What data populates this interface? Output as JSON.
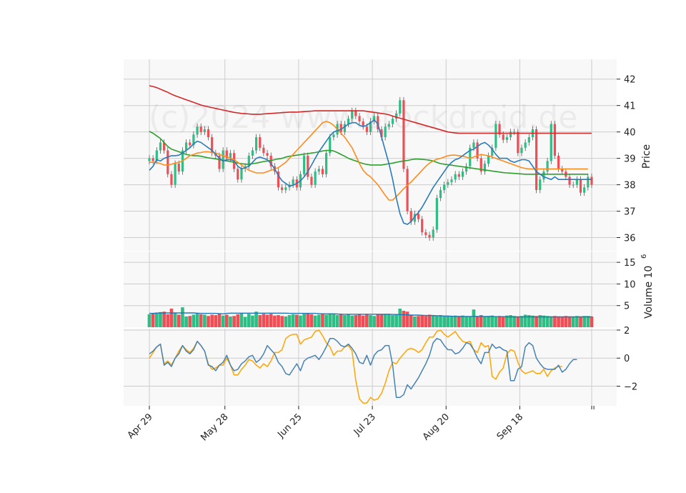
{
  "watermark": "(c)2024 www.stockdroid.de",
  "colors": {
    "up": "#2ebd85",
    "down": "#f04d55",
    "ma_short": "#2b7bb9",
    "ma_mid": "#ff8c1a",
    "ma_long1": "#2ca02c",
    "ma_long2": "#d62728",
    "vol_avg": "#1f77b4",
    "osc_a": "#4682b4",
    "osc_b": "#ffa500",
    "grid": "#cccccc",
    "panel_bg": "#f8f8f8"
  },
  "chart_data": {
    "type": "candlestick",
    "x_tick_labels": [
      "Apr 29",
      "May 28",
      "Jun 25",
      "Jul 23",
      "Aug 20",
      "Sep 18"
    ],
    "panels": {
      "price": {
        "ylabel": "Price",
        "yticks": [
          36,
          37,
          38,
          39,
          40,
          41,
          42
        ],
        "ylim": [
          35.5,
          42.75
        ]
      },
      "volume": {
        "ylabel": "Volume  10",
        "ylabel_exponent": "6",
        "yticks": [
          5,
          10,
          15
        ],
        "ylim": [
          0,
          17.5
        ]
      },
      "oscillator": {
        "yticks": [
          -2,
          0,
          2
        ],
        "ylim": [
          -3.4,
          2.1
        ]
      }
    },
    "close": [
      39.0,
      38.9,
      39.3,
      39.6,
      39.3,
      38.4,
      38.0,
      38.8,
      38.5,
      39.3,
      39.6,
      39.5,
      39.9,
      40.2,
      40.0,
      40.1,
      39.8,
      39.2,
      39.1,
      38.6,
      39.3,
      39.0,
      39.2,
      38.6,
      38.2,
      38.6,
      38.7,
      39.1,
      39.3,
      39.8,
      39.4,
      39.2,
      39.1,
      38.7,
      38.5,
      37.9,
      37.8,
      37.9,
      38.0,
      38.2,
      37.9,
      38.4,
      39.1,
      38.3,
      38.0,
      38.5,
      38.6,
      38.4,
      39.2,
      39.8,
      39.9,
      40.3,
      40.0,
      40.3,
      40.5,
      40.8,
      40.6,
      40.4,
      40.2,
      40.0,
      40.4,
      40.6,
      40.1,
      39.8,
      40.2,
      40.3,
      40.5,
      40.7,
      41.2,
      38.6,
      37.0,
      36.6,
      36.9,
      36.7,
      36.2,
      36.1,
      36.0,
      36.3,
      37.5,
      37.8,
      38.0,
      38.1,
      38.2,
      38.4,
      38.3,
      38.5,
      38.7,
      39.4,
      39.6,
      39.0,
      38.5,
      38.8,
      39.1,
      39.4,
      40.3,
      39.9,
      39.7,
      39.8,
      40.0,
      40.0,
      39.2,
      39.4,
      39.6,
      39.8,
      40.1,
      37.8,
      38.2,
      38.5,
      38.9,
      40.3,
      39.1,
      38.6,
      38.5,
      38.3,
      38.0,
      38.0,
      38.2,
      37.7,
      37.9,
      38.3,
      38.0
    ],
    "ma_short": [
      38.55,
      38.7,
      38.95,
      38.9,
      39.0,
      39.05,
      39.1,
      39.1,
      39.12,
      39.2,
      39.3,
      39.4,
      39.55,
      39.65,
      39.6,
      39.5,
      39.4,
      39.3,
      39.15,
      39.0,
      38.9,
      38.95,
      38.95,
      38.9,
      38.7,
      38.6,
      38.65,
      38.7,
      38.85,
      39.0,
      39.05,
      39.0,
      38.95,
      38.8,
      38.6,
      38.35,
      38.15,
      38.05,
      37.95,
      37.98,
      38.05,
      38.15,
      38.3,
      38.5,
      38.75,
      39.0,
      39.25,
      39.45,
      39.65,
      39.85,
      40.0,
      40.05,
      40.1,
      40.2,
      40.3,
      40.35,
      40.35,
      40.25,
      40.2,
      40.25,
      40.35,
      40.45,
      40.3,
      39.8,
      39.3,
      38.8,
      38.2,
      37.5,
      36.9,
      36.55,
      36.5,
      36.6,
      36.8,
      36.95,
      37.15,
      37.4,
      37.65,
      37.9,
      38.1,
      38.3,
      38.5,
      38.7,
      38.85,
      38.95,
      39.0,
      39.1,
      39.2,
      39.3,
      39.35,
      39.45,
      39.55,
      39.6,
      39.5,
      39.35,
      39.15,
      39.0,
      39.0,
      39.0,
      38.9,
      38.85,
      38.9,
      38.95,
      38.95,
      38.9,
      38.7,
      38.5,
      38.4,
      38.3,
      38.25,
      38.2,
      38.3,
      38.2,
      38.2,
      38.2,
      38.2,
      38.2,
      38.2,
      38.2,
      38.2,
      38.2,
      38.2
    ],
    "ma_mid": [
      38.85,
      38.85,
      38.85,
      38.8,
      38.75,
      38.75,
      38.78,
      38.82,
      38.85,
      38.9,
      39.0,
      39.1,
      39.15,
      39.2,
      39.22,
      39.25,
      39.25,
      39.22,
      39.2,
      39.15,
      39.1,
      39.05,
      39.0,
      38.95,
      38.85,
      38.75,
      38.65,
      38.55,
      38.5,
      38.45,
      38.45,
      38.45,
      38.5,
      38.55,
      38.6,
      38.65,
      38.75,
      38.85,
      39.0,
      39.15,
      39.3,
      39.45,
      39.6,
      39.75,
      39.9,
      40.05,
      40.2,
      40.35,
      40.4,
      40.35,
      40.25,
      40.1,
      39.95,
      39.8,
      39.6,
      39.4,
      39.1,
      38.8,
      38.55,
      38.4,
      38.3,
      38.15,
      38.0,
      37.8,
      37.6,
      37.42,
      37.42,
      37.55,
      37.7,
      37.85,
      37.98,
      38.1,
      38.25,
      38.4,
      38.55,
      38.7,
      38.82,
      38.9,
      38.97,
      39.0,
      39.05,
      39.1,
      39.12,
      39.12,
      39.1,
      39.08,
      39.05,
      39.0,
      39.05,
      39.1,
      39.15,
      39.12,
      39.1,
      39.05,
      39.0,
      38.95,
      38.9,
      38.85,
      38.8,
      38.75,
      38.7,
      38.65,
      38.62,
      38.6,
      38.6,
      38.6,
      38.6,
      38.6,
      38.6,
      38.6,
      38.6,
      38.6,
      38.6,
      38.6,
      38.6,
      38.6,
      38.6,
      38.6,
      38.6,
      38.6
    ],
    "ma_long1": [
      40.02,
      39.95,
      39.85,
      39.75,
      39.6,
      39.45,
      39.35,
      39.3,
      39.25,
      39.2,
      39.15,
      39.12,
      39.1,
      39.1,
      39.08,
      39.05,
      39.02,
      39.0,
      38.98,
      38.95,
      38.92,
      38.9,
      38.88,
      38.85,
      38.82,
      38.8,
      38.78,
      38.78,
      38.8,
      38.82,
      38.85,
      38.88,
      38.9,
      38.92,
      38.95,
      38.98,
      39.0,
      39.05,
      39.08,
      39.1,
      39.12,
      39.14,
      39.16,
      39.18,
      39.2,
      39.22,
      39.25,
      39.28,
      39.3,
      39.3,
      39.28,
      39.22,
      39.15,
      39.08,
      39.0,
      38.95,
      38.9,
      38.85,
      38.8,
      38.77,
      38.75,
      38.75,
      38.75,
      38.75,
      38.77,
      38.8,
      38.82,
      38.85,
      38.88,
      38.9,
      38.92,
      38.95,
      38.97,
      38.97,
      38.96,
      38.95,
      38.93,
      38.9,
      38.85,
      38.8,
      38.78,
      38.76,
      38.74,
      38.72,
      38.7,
      38.68,
      38.66,
      38.64,
      38.62,
      38.6,
      38.58,
      38.56,
      38.54,
      38.52,
      38.5,
      38.48,
      38.46,
      38.45,
      38.44,
      38.43,
      38.42,
      38.41,
      38.4,
      38.4,
      38.4,
      38.4,
      38.4,
      38.4,
      38.4,
      38.4,
      38.4,
      38.4,
      38.4,
      38.4,
      38.4,
      38.4,
      38.4,
      38.4,
      38.4,
      38.4
    ],
    "ma_long2": [
      41.75,
      41.72,
      41.68,
      41.62,
      41.56,
      41.5,
      41.43,
      41.37,
      41.32,
      41.27,
      41.22,
      41.17,
      41.12,
      41.07,
      41.02,
      40.98,
      40.95,
      40.92,
      40.89,
      40.86,
      40.83,
      40.8,
      40.77,
      40.74,
      40.72,
      40.7,
      40.69,
      40.68,
      40.67,
      40.67,
      40.67,
      40.68,
      40.69,
      40.7,
      40.71,
      40.72,
      40.73,
      40.74,
      40.75,
      40.75,
      40.75,
      40.76,
      40.77,
      40.78,
      40.79,
      40.8,
      40.8,
      40.8,
      40.8,
      40.8,
      40.8,
      40.8,
      40.8,
      40.8,
      40.8,
      40.8,
      40.8,
      40.8,
      40.8,
      40.78,
      40.76,
      40.74,
      40.72,
      40.7,
      40.68,
      40.65,
      40.6,
      40.56,
      40.52,
      40.48,
      40.44,
      40.4,
      40.36,
      40.32,
      40.28,
      40.24,
      40.2,
      40.16,
      40.12,
      40.08,
      40.04,
      40.0,
      39.98,
      39.96,
      39.95,
      39.95,
      39.95,
      39.95,
      39.95,
      39.95,
      39.95,
      39.95,
      39.95,
      39.95,
      39.95,
      39.95,
      39.95,
      39.95,
      39.95,
      39.95,
      39.95,
      39.95,
      39.95,
      39.95,
      39.95,
      39.95,
      39.95,
      39.95,
      39.95,
      39.95,
      39.95,
      39.95,
      39.95,
      39.95,
      39.95,
      39.95,
      39.95,
      39.95,
      39.95,
      39.95,
      39.95
    ],
    "volume": [
      3.0,
      3.2,
      3.4,
      3.5,
      3.6,
      3.0,
      4.3,
      3.3,
      2.9,
      4.6,
      2.5,
      2.6,
      2.9,
      3.2,
      3.0,
      2.9,
      2.6,
      2.9,
      2.8,
      3.1,
      2.7,
      2.9,
      2.5,
      2.6,
      3.0,
      3.3,
      2.4,
      3.1,
      2.7,
      3.6,
      2.8,
      3.1,
      2.9,
      3.1,
      2.7,
      2.8,
      2.6,
      2.5,
      2.8,
      3.0,
      2.9,
      2.7,
      3.1,
      3.3,
      3.0,
      2.7,
      2.9,
      3.1,
      2.9,
      3.2,
      3.0,
      2.8,
      3.1,
      2.8,
      3.0,
      2.7,
      2.8,
      3.0,
      2.7,
      2.9,
      2.8,
      2.6,
      2.9,
      3.0,
      3.1,
      2.9,
      2.8,
      2.9,
      4.3,
      3.8,
      3.6,
      2.8,
      2.5,
      2.6,
      2.7,
      2.6,
      2.9,
      2.7,
      2.6,
      2.8,
      2.5,
      2.6,
      2.5,
      2.7,
      2.6,
      2.7,
      2.4,
      2.5,
      4.1,
      2.6,
      2.8,
      2.4,
      2.6,
      2.7,
      2.5,
      2.6,
      2.5,
      2.7,
      2.8,
      2.6,
      2.5,
      2.6,
      2.9,
      2.8,
      2.7,
      2.6,
      2.8,
      2.7,
      2.6,
      2.5,
      2.6,
      2.5,
      2.4,
      2.6,
      2.5,
      2.4,
      2.6,
      2.5,
      2.6,
      2.6,
      2.5
    ],
    "volume_avg": [
      3.2,
      3.2,
      3.25,
      3.3,
      3.3,
      3.3,
      3.3,
      3.3,
      3.3,
      3.3,
      3.3,
      3.3,
      3.3,
      3.25,
      3.2,
      3.2,
      3.2,
      3.2,
      3.2,
      3.15,
      3.1,
      3.2,
      3.25,
      3.25,
      3.25,
      3.25,
      3.25,
      3.25,
      3.25,
      3.25,
      3.25,
      3.25,
      3.25,
      3.25,
      3.25,
      3.25,
      3.25,
      3.25,
      3.2,
      3.2,
      3.2,
      3.2,
      3.2,
      3.2,
      3.2,
      3.2,
      3.15,
      3.1,
      3.1,
      3.1,
      3.1,
      3.05,
      3.0,
      3.0,
      3.0,
      3.0,
      3.0,
      3.0,
      3.0,
      3.0,
      3.0,
      3.0,
      3.0,
      3.0,
      3.0,
      3.0,
      2.95,
      2.95,
      2.9,
      2.9,
      2.85,
      2.8,
      2.8,
      2.8,
      2.75,
      2.7,
      2.7,
      2.7,
      2.65,
      2.65,
      2.6,
      2.6,
      2.55,
      2.5,
      2.5,
      2.5,
      2.5,
      2.5,
      2.5,
      2.5,
      2.5,
      2.5,
      2.5,
      2.5,
      2.45,
      2.45,
      2.45,
      2.4,
      2.4,
      2.4,
      2.4,
      2.4,
      2.4,
      2.4,
      2.4,
      2.4,
      2.4,
      2.4,
      2.4,
      2.4,
      2.4,
      2.4,
      2.4,
      2.4,
      2.4,
      2.4,
      2.4,
      2.4,
      2.4,
      2.4,
      2.4
    ],
    "osc_a": [
      0.3,
      0.5,
      0.8,
      1.0,
      -0.5,
      -0.3,
      -0.6,
      0.0,
      0.3,
      0.9,
      0.5,
      0.3,
      0.6,
      1.2,
      0.9,
      0.5,
      -0.5,
      -0.6,
      -0.9,
      -0.5,
      -0.3,
      0.2,
      -0.5,
      -0.9,
      -0.8,
      -0.4,
      -0.2,
      0.1,
      0.2,
      -0.3,
      -0.1,
      0.3,
      0.9,
      0.6,
      0.3,
      -0.3,
      -0.6,
      -1.1,
      -1.2,
      -0.8,
      -0.4,
      -0.9,
      -0.2,
      0.0,
      0.1,
      0.2,
      -0.1,
      0.3,
      0.8,
      1.4,
      1.4,
      1.2,
      0.9,
      0.8,
      1.0,
      0.7,
      0.3,
      -0.3,
      -0.4,
      0.2,
      -0.5,
      0.2,
      0.5,
      0.6,
      0.9,
      0.9,
      -0.5,
      -2.8,
      -2.8,
      -2.6,
      -1.9,
      -2.2,
      -1.8,
      -1.4,
      -0.9,
      -0.4,
      0.2,
      1.1,
      1.4,
      1.3,
      0.9,
      0.6,
      0.6,
      0.3,
      0.4,
      0.7,
      1.1,
      1.0,
      0.6,
      0.0,
      -0.4,
      0.4,
      0.4,
      1.0,
      0.7,
      0.8,
      0.6,
      0.5,
      -1.6,
      -1.6,
      -0.8,
      -0.6,
      0.8,
      1.1,
      0.9,
      0.0,
      -0.4,
      -0.7,
      -0.8,
      -0.8,
      -0.8,
      -0.5,
      -1.0,
      -0.8,
      -0.4,
      -0.1,
      -0.1
    ],
    "osc_b": [
      0.0,
      0.4,
      0.8,
      1.0,
      -0.4,
      -0.2,
      -0.5,
      0.0,
      0.5,
      0.9,
      0.6,
      0.4,
      0.7,
      1.2,
      0.9,
      0.5,
      -0.4,
      -0.8,
      -0.7,
      -0.5,
      -0.5,
      0.0,
      -0.5,
      -1.2,
      -1.2,
      -0.8,
      -0.5,
      -0.1,
      -0.2,
      -0.5,
      -0.7,
      -0.4,
      -0.6,
      -0.2,
      0.4,
      0.4,
      0.6,
      1.4,
      1.6,
      1.7,
      1.7,
      1.0,
      1.3,
      1.4,
      1.5,
      1.9,
      2.0,
      1.6,
      1.1,
      0.8,
      0.2,
      0.5,
      0.5,
      0.8,
      0.9,
      0.5,
      -1.6,
      -2.9,
      -3.2,
      -3.2,
      -2.8,
      -3.0,
      -2.9,
      -2.5,
      -1.8,
      -0.9,
      -0.3,
      -0.4,
      0.0,
      0.3,
      0.6,
      0.7,
      0.6,
      0.4,
      0.6,
      1.1,
      1.5,
      1.5,
      1.9,
      2.0,
      1.7,
      1.5,
      1.7,
      1.9,
      1.5,
      1.2,
      1.1,
      1.2,
      0.6,
      0.4,
      1.1,
      0.8,
      0.9,
      -1.3,
      -1.5,
      -1.0,
      -0.7,
      0.3,
      0.6,
      0.5,
      -0.3,
      -0.9,
      -1.1,
      -1.0,
      -0.9,
      -1.1,
      -1.1,
      -0.8,
      -1.3,
      -0.9,
      -0.7,
      -0.6,
      -0.6
    ]
  }
}
